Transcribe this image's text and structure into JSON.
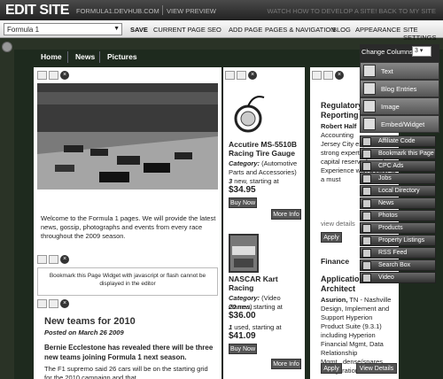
{
  "topbar": {
    "edit": "EDIT SITE",
    "url": "FORMULA1.DEVHUB.COM",
    "preview": "VIEW PREVIEW",
    "watch": "WATCH HOW TO DEVELOP A SITE!  BACK TO MY SITE"
  },
  "toolbar": {
    "page": "Formula 1",
    "save": "SAVE",
    "seo": "CURRENT PAGE SEO",
    "add": "ADD PAGE",
    "pages": "PAGES & NAVIGATION",
    "blog": "BLOG",
    "appearance": "APPEARANCE",
    "settings": "SITE SETTINGS"
  },
  "nav": [
    "Home",
    "News",
    "Pictures"
  ],
  "col1": {
    "welcome": "Welcome to the Formula 1 pages. We will provide the latest news, gossip, photographs and events from every race throughout the 2009 season.",
    "bookmark": "Bookmark this Page Widget with javascript or flash cannot be displayed in the editor",
    "news_title": "New teams for 2010",
    "posted": "Posted on March 26 2009",
    "headline": "Bernie Ecclestone has revealed there will be three new teams joining Formula 1 next season.",
    "body": "The F1 supremo said 26 cars will be on the starting grid for the 2010 campaign and that"
  },
  "col2": {
    "p1_title": "Accutire MS-5510B Racing Tire Gauge",
    "p1_cat_label": "Category:",
    "p1_cat": "(Automotive Parts and Accessories)",
    "p1_new_count": "3",
    "p1_new": "new, starting at",
    "p1_price": "$34.95",
    "buy": "Buy Now",
    "more": "More Info",
    "p2_title": "NASCAR Kart Racing",
    "p2_cat_label": "Category:",
    "p2_cat": "(Video Games)",
    "p2_new_count": "20",
    "p2_new": "new, starting at",
    "p2_price1": "$36.00",
    "p2_used_count": "1",
    "p2_used": "used, starting at",
    "p2_price2": "$41.09"
  },
  "col3": {
    "job1_title": "Regulatory Reporting",
    "job1_co": "Robert Half",
    "job1_line2": "Accounting",
    "job1_text": "Jersey City experience, strong expertise 15c3-1 capital reserve formula Experience with Dealer is a must",
    "view": "view details",
    "apply": "Apply",
    "finance": "Finance",
    "job2_title": "Application Architect",
    "job2_co": "Asurion,",
    "job2_text": "TN - Nashville Design, Implement and Support Hyperion Product Suite (9.3.1) including Hyperion Financial Mgmt, Data Relationship Mgmt...dense/spares configuration...",
    "view_btn": "View Details"
  },
  "widgets": {
    "change_columns": "Change Columns",
    "columns_value": "3",
    "big": [
      "Text",
      "Blog Entries",
      "Image",
      "Embed/Widget"
    ],
    "small": [
      "Affiliate Code",
      "Bookmark this Page",
      "CPC Ads",
      "Jobs",
      "Local Directory",
      "News",
      "Photos",
      "Products",
      "Property Listings",
      "RSS Feed",
      "Search Box",
      "Video"
    ]
  }
}
